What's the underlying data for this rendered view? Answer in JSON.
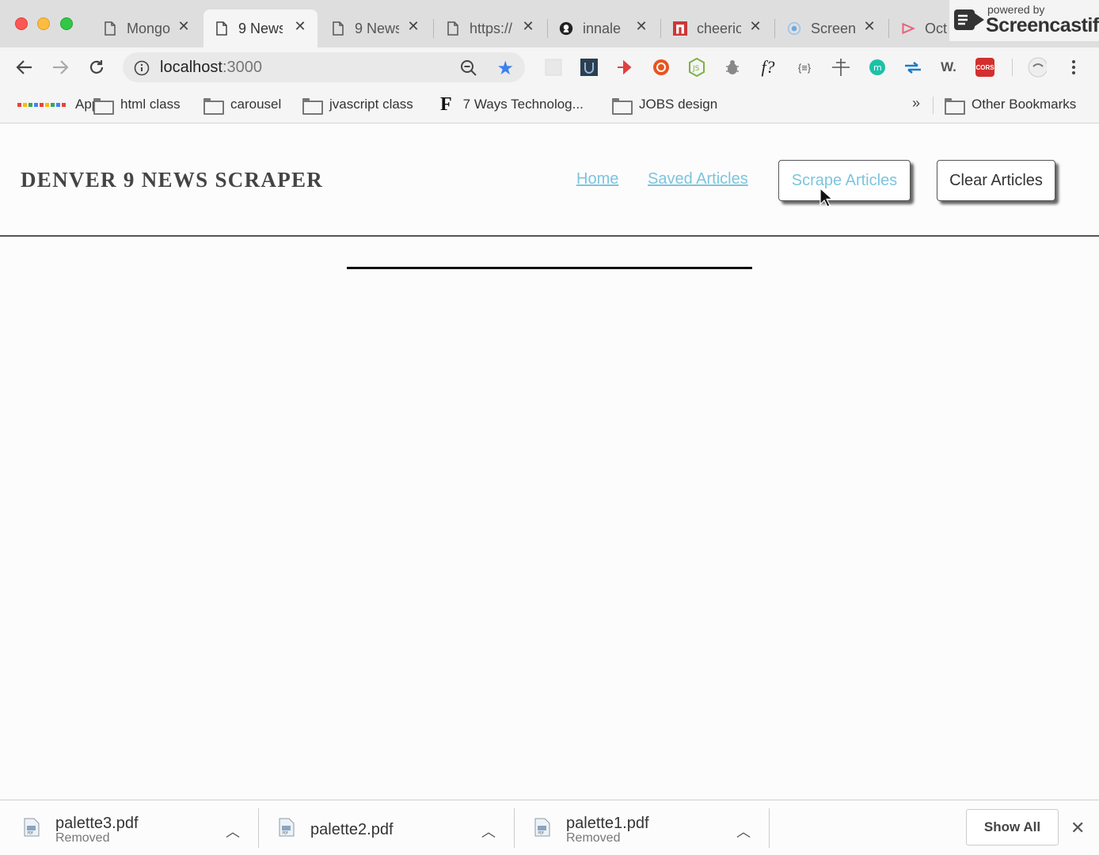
{
  "tabs": [
    {
      "title": "Mongo"
    },
    {
      "title": "9 News"
    },
    {
      "title": "9 News"
    },
    {
      "title": "https://"
    },
    {
      "title": "innale"
    },
    {
      "title": "cheerio"
    },
    {
      "title": "Screen"
    },
    {
      "title": "Oct"
    }
  ],
  "watermark": {
    "powered": "powered by",
    "name": "Screencastify"
  },
  "toolbar": {
    "url_host": "localhost",
    "url_port": ":3000",
    "ext_function_label": "f?",
    "ext_json_label": "{≡}",
    "ext_w_label": "W.",
    "ext_cors_label": "CORS"
  },
  "bookmarks": {
    "items": [
      {
        "label": "Apps"
      },
      {
        "label": "html class"
      },
      {
        "label": "carousel"
      },
      {
        "label": "jvascript class"
      },
      {
        "label": "7 Ways Technolog..."
      },
      {
        "label": "JOBS design"
      }
    ],
    "overflow": "»",
    "other": "Other Bookmarks"
  },
  "site": {
    "title": "DENVER 9 NEWS SCRAPER",
    "nav_home": "Home",
    "nav_saved": "Saved Articles",
    "btn_scrape": "Scrape Articles",
    "btn_clear": "Clear Articles"
  },
  "downloads": {
    "items": [
      {
        "name": "palette3.pdf",
        "status": "Removed"
      },
      {
        "name": "palette2.pdf",
        "status": ""
      },
      {
        "name": "palette1.pdf",
        "status": "Removed"
      }
    ],
    "show_all": "Show All"
  },
  "colors": {
    "link": "#7dc4de",
    "star": "#3b80f0"
  }
}
